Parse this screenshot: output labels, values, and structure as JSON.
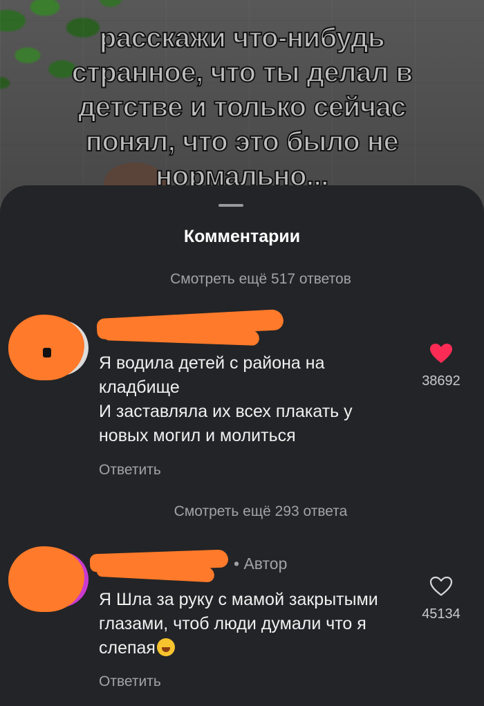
{
  "video": {
    "overlay_text": "расскажи что-нибудь странное, что ты делал в детстве и только сейчас понял, что это было не нормально..."
  },
  "sheet": {
    "title": "Комментарии",
    "more_replies_top": "Смотреть ещё 517 ответов",
    "more_replies_middle": "Смотреть ещё 293 ответа"
  },
  "comments": [
    {
      "text": "Я водила детей с района на кладбище\nИ заставляла их всех плакать у новых могил и молиться",
      "reply_label": "Ответить",
      "likes": "38692",
      "liked": true
    },
    {
      "author_tag": "• Автор",
      "text": "Я Шла за руку с мамой закрытыми глазами, чтоб люди думали что я слепая",
      "reply_label": "Ответить",
      "likes": "45134",
      "liked": false
    }
  ],
  "colors": {
    "sheet_bg": "#232427",
    "heart_active": "#fe2c55",
    "redaction": "#ff7a2a"
  },
  "icons": {
    "like_active": "heart-filled-icon",
    "like_inactive": "heart-outline-icon",
    "emoji": "rolling-laughing-emoji"
  }
}
